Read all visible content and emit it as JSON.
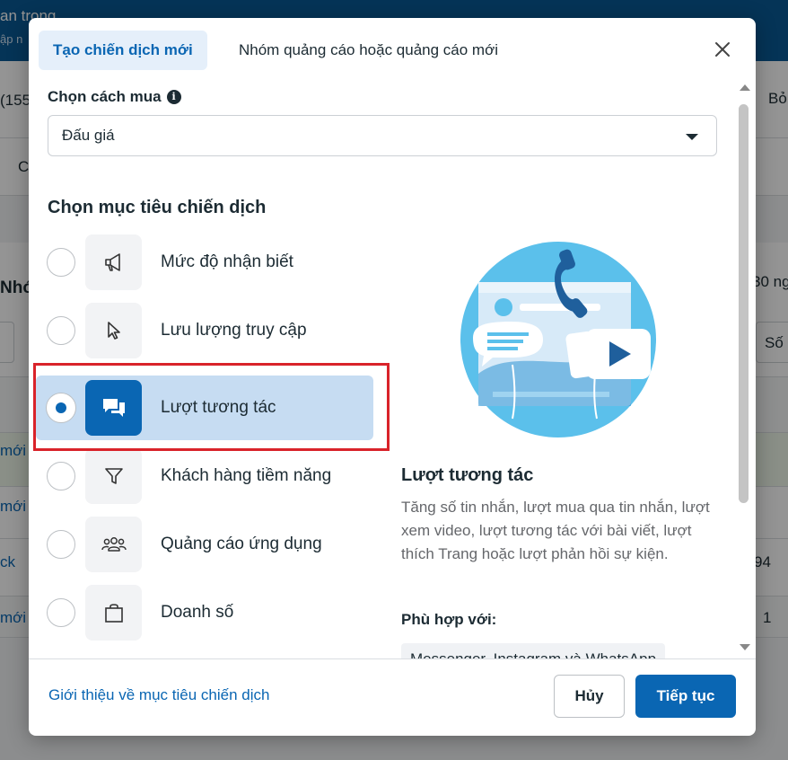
{
  "background": {
    "top_title": "an trọng",
    "top_sub": "ập n",
    "left_fragments": [
      "(155",
      "C",
      "Nhó",
      "mới",
      "mới",
      "ck",
      "mới"
    ],
    "right_fragments": [
      "Bỏ",
      "30 ng",
      "Số",
      "94",
      "1"
    ]
  },
  "modal": {
    "tabs": [
      {
        "label": "Tạo chiến dịch mới",
        "active": true
      },
      {
        "label": "Nhóm quảng cáo hoặc quảng cáo mới",
        "active": false
      }
    ],
    "buy_type": {
      "label": "Chọn cách mua",
      "info_icon": "i",
      "value": "Đấu giá"
    },
    "goal_label": "Chọn mục tiêu chiến dịch",
    "options": [
      {
        "label": "Mức độ nhận biết",
        "icon": "megaphone-icon",
        "selected": false
      },
      {
        "label": "Lưu lượng truy cập",
        "icon": "cursor-icon",
        "selected": false
      },
      {
        "label": "Lượt tương tác",
        "icon": "chat-bubbles-icon",
        "selected": true
      },
      {
        "label": "Khách hàng tiềm năng",
        "icon": "funnel-icon",
        "selected": false
      },
      {
        "label": "Quảng cáo ứng dụng",
        "icon": "people-icon",
        "selected": false
      },
      {
        "label": "Doanh số",
        "icon": "shopping-bag-icon",
        "selected": false
      }
    ],
    "detail": {
      "title": "Lượt tương tác",
      "description": "Tăng số tin nhắn, lượt mua qua tin nhắn, lượt xem video, lượt tương tác với bài viết, lượt thích Trang hoặc lượt phản hồi sự kiện.",
      "fit_label": "Phù hợp với:",
      "fit_value": "Messenger, Instagram và WhatsApp"
    },
    "footer": {
      "link": "Giới thiệu về mục tiêu chiến dịch",
      "cancel": "Hủy",
      "continue": "Tiếp tục"
    }
  },
  "colors": {
    "accent": "#0a66b3",
    "selected_bg": "#c6dcf2",
    "highlight": "#d9232a",
    "illustration": "#5bc0eb"
  }
}
